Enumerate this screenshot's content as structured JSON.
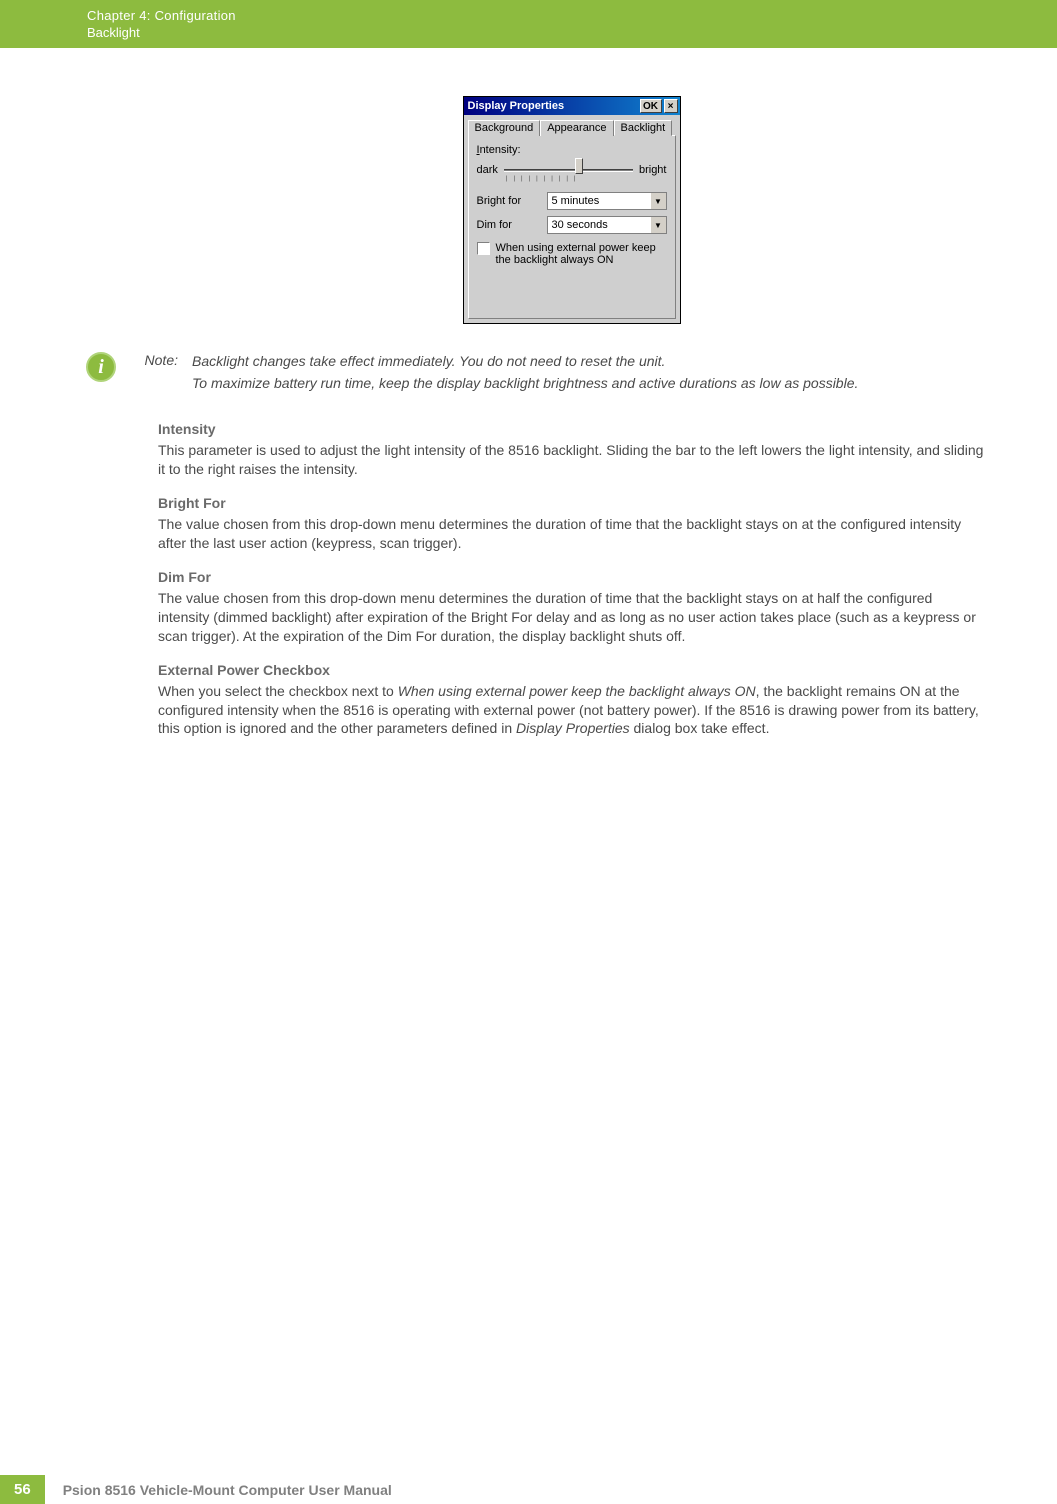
{
  "header": {
    "chapter": "Chapter 4:  Configuration",
    "section": "Backlight"
  },
  "dialog": {
    "title": "Display Properties",
    "ok": "OK",
    "close": "×",
    "tabs": [
      "Background",
      "Appearance",
      "Backlight"
    ],
    "intensity_label": "Intensity:",
    "dark": "dark",
    "bright": "bright",
    "bright_for_label": "Bright for",
    "bright_for_value": "5 minutes",
    "dim_for_label": "Dim for",
    "dim_for_value": "30 seconds",
    "checkbox_text": "When using external power keep the backlight always ON"
  },
  "note": {
    "label": "Note:",
    "line1": "Backlight changes take effect immediately. You do not need to reset the unit.",
    "line2": "To maximize battery run time, keep the display backlight brightness and active durations as low as possible."
  },
  "sections": {
    "intensity": {
      "h": "Intensity",
      "p": "This parameter is used to adjust the light intensity of the 8516 backlight. Sliding the bar to the left lowers the light intensity, and sliding it to the right raises the intensity."
    },
    "bright_for": {
      "h": "Bright For",
      "p": "The value chosen from this drop-down menu determines the duration of time that the backlight stays on at the configured intensity after the last user action (keypress, scan trigger)."
    },
    "dim_for": {
      "h": "Dim For",
      "p": "The value chosen from this drop-down menu determines the duration of time that the backlight stays on at half the configured intensity (dimmed backlight) after expiration of the Bright For delay and as long as no user action takes place (such as a keypress or scan trigger). At the expiration of the Dim For duration, the display backlight shuts off."
    },
    "external": {
      "h": "External Power Checkbox",
      "p_prefix": "When you select the checkbox next to ",
      "p_ital1": "When using external power keep the backlight always ON",
      "p_mid": ", the backlight remains ON at the configured intensity when the 8516 is operating with external power (not battery power). If the 8516 is drawing power from its battery, this option is ignored and the other parameters defined in ",
      "p_ital2": "Display Properties",
      "p_suffix": " dialog box take effect."
    }
  },
  "footer": {
    "page": "56",
    "title": "Psion 8516 Vehicle-Mount Computer User Manual"
  }
}
